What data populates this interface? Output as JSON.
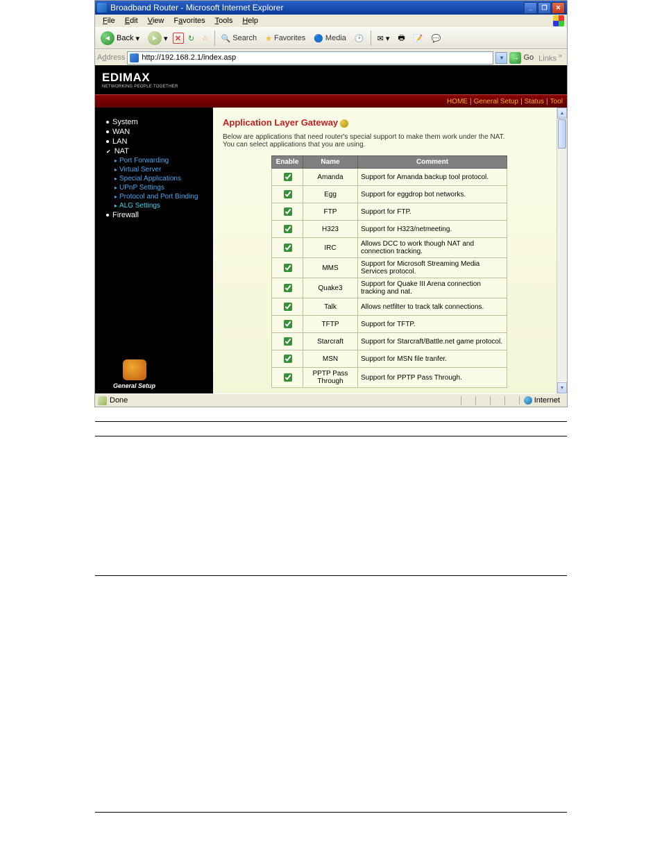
{
  "window": {
    "title": "Broadband Router - Microsoft Internet Explorer",
    "menus": [
      "File",
      "Edit",
      "View",
      "Favorites",
      "Tools",
      "Help"
    ],
    "back": "Back",
    "search": "Search",
    "favorites": "Favorites",
    "media": "Media",
    "addr_label": "Address",
    "url": "http://192.168.2.1/index.asp",
    "go": "Go",
    "links": "Links"
  },
  "brand": {
    "name": "EDIMAX",
    "tag": "NETWORKING PEOPLE TOGETHER"
  },
  "topnav": {
    "home": "HOME",
    "general": "General Setup",
    "status": "Status",
    "tool": "Tool"
  },
  "sidebar": {
    "items": [
      {
        "label": "System",
        "type": "main"
      },
      {
        "label": "WAN",
        "type": "main"
      },
      {
        "label": "LAN",
        "type": "main"
      },
      {
        "label": "NAT",
        "type": "main",
        "active": true
      },
      {
        "label": "Port Forwarding",
        "type": "sub"
      },
      {
        "label": "Virtual Server",
        "type": "sub"
      },
      {
        "label": "Special Applications",
        "type": "sub"
      },
      {
        "label": "UPnP Settings",
        "type": "sub"
      },
      {
        "label": "Protocol and Port Binding",
        "type": "sub"
      },
      {
        "label": "ALG Settings",
        "type": "sub",
        "active": true
      },
      {
        "label": "Firewall",
        "type": "main"
      }
    ],
    "footer": "General Setup"
  },
  "page_title": "Application Layer Gateway",
  "description": "Below are applications that need router's special support to make them work under the NAT. You can select applications that you are using.",
  "table": {
    "headers": [
      "Enable",
      "Name",
      "Comment"
    ],
    "rows": [
      {
        "enabled": true,
        "name": "Amanda",
        "comment": "Support for Amanda backup tool protocol."
      },
      {
        "enabled": true,
        "name": "Egg",
        "comment": "Support for eggdrop bot networks."
      },
      {
        "enabled": true,
        "name": "FTP",
        "comment": "Support for FTP."
      },
      {
        "enabled": true,
        "name": "H323",
        "comment": "Support for H323/netmeeting."
      },
      {
        "enabled": true,
        "name": "IRC",
        "comment": "Allows DCC to work though NAT and connection tracking."
      },
      {
        "enabled": true,
        "name": "MMS",
        "comment": "Support for Microsoft Streaming Media Services protocol."
      },
      {
        "enabled": true,
        "name": "Quake3",
        "comment": "Support for Quake III Arena connection tracking and nat."
      },
      {
        "enabled": true,
        "name": "Talk",
        "comment": "Allows netfilter to track talk connections."
      },
      {
        "enabled": true,
        "name": "TFTP",
        "comment": "Support for TFTP."
      },
      {
        "enabled": true,
        "name": "Starcraft",
        "comment": "Support for Starcraft/Battle.net game protocol."
      },
      {
        "enabled": true,
        "name": "MSN",
        "comment": "Support for MSN file tranfer."
      },
      {
        "enabled": true,
        "name": "PPTP Pass Through",
        "comment": "Support for PPTP Pass Through."
      }
    ]
  },
  "status": {
    "done": "Done",
    "zone": "Internet"
  }
}
